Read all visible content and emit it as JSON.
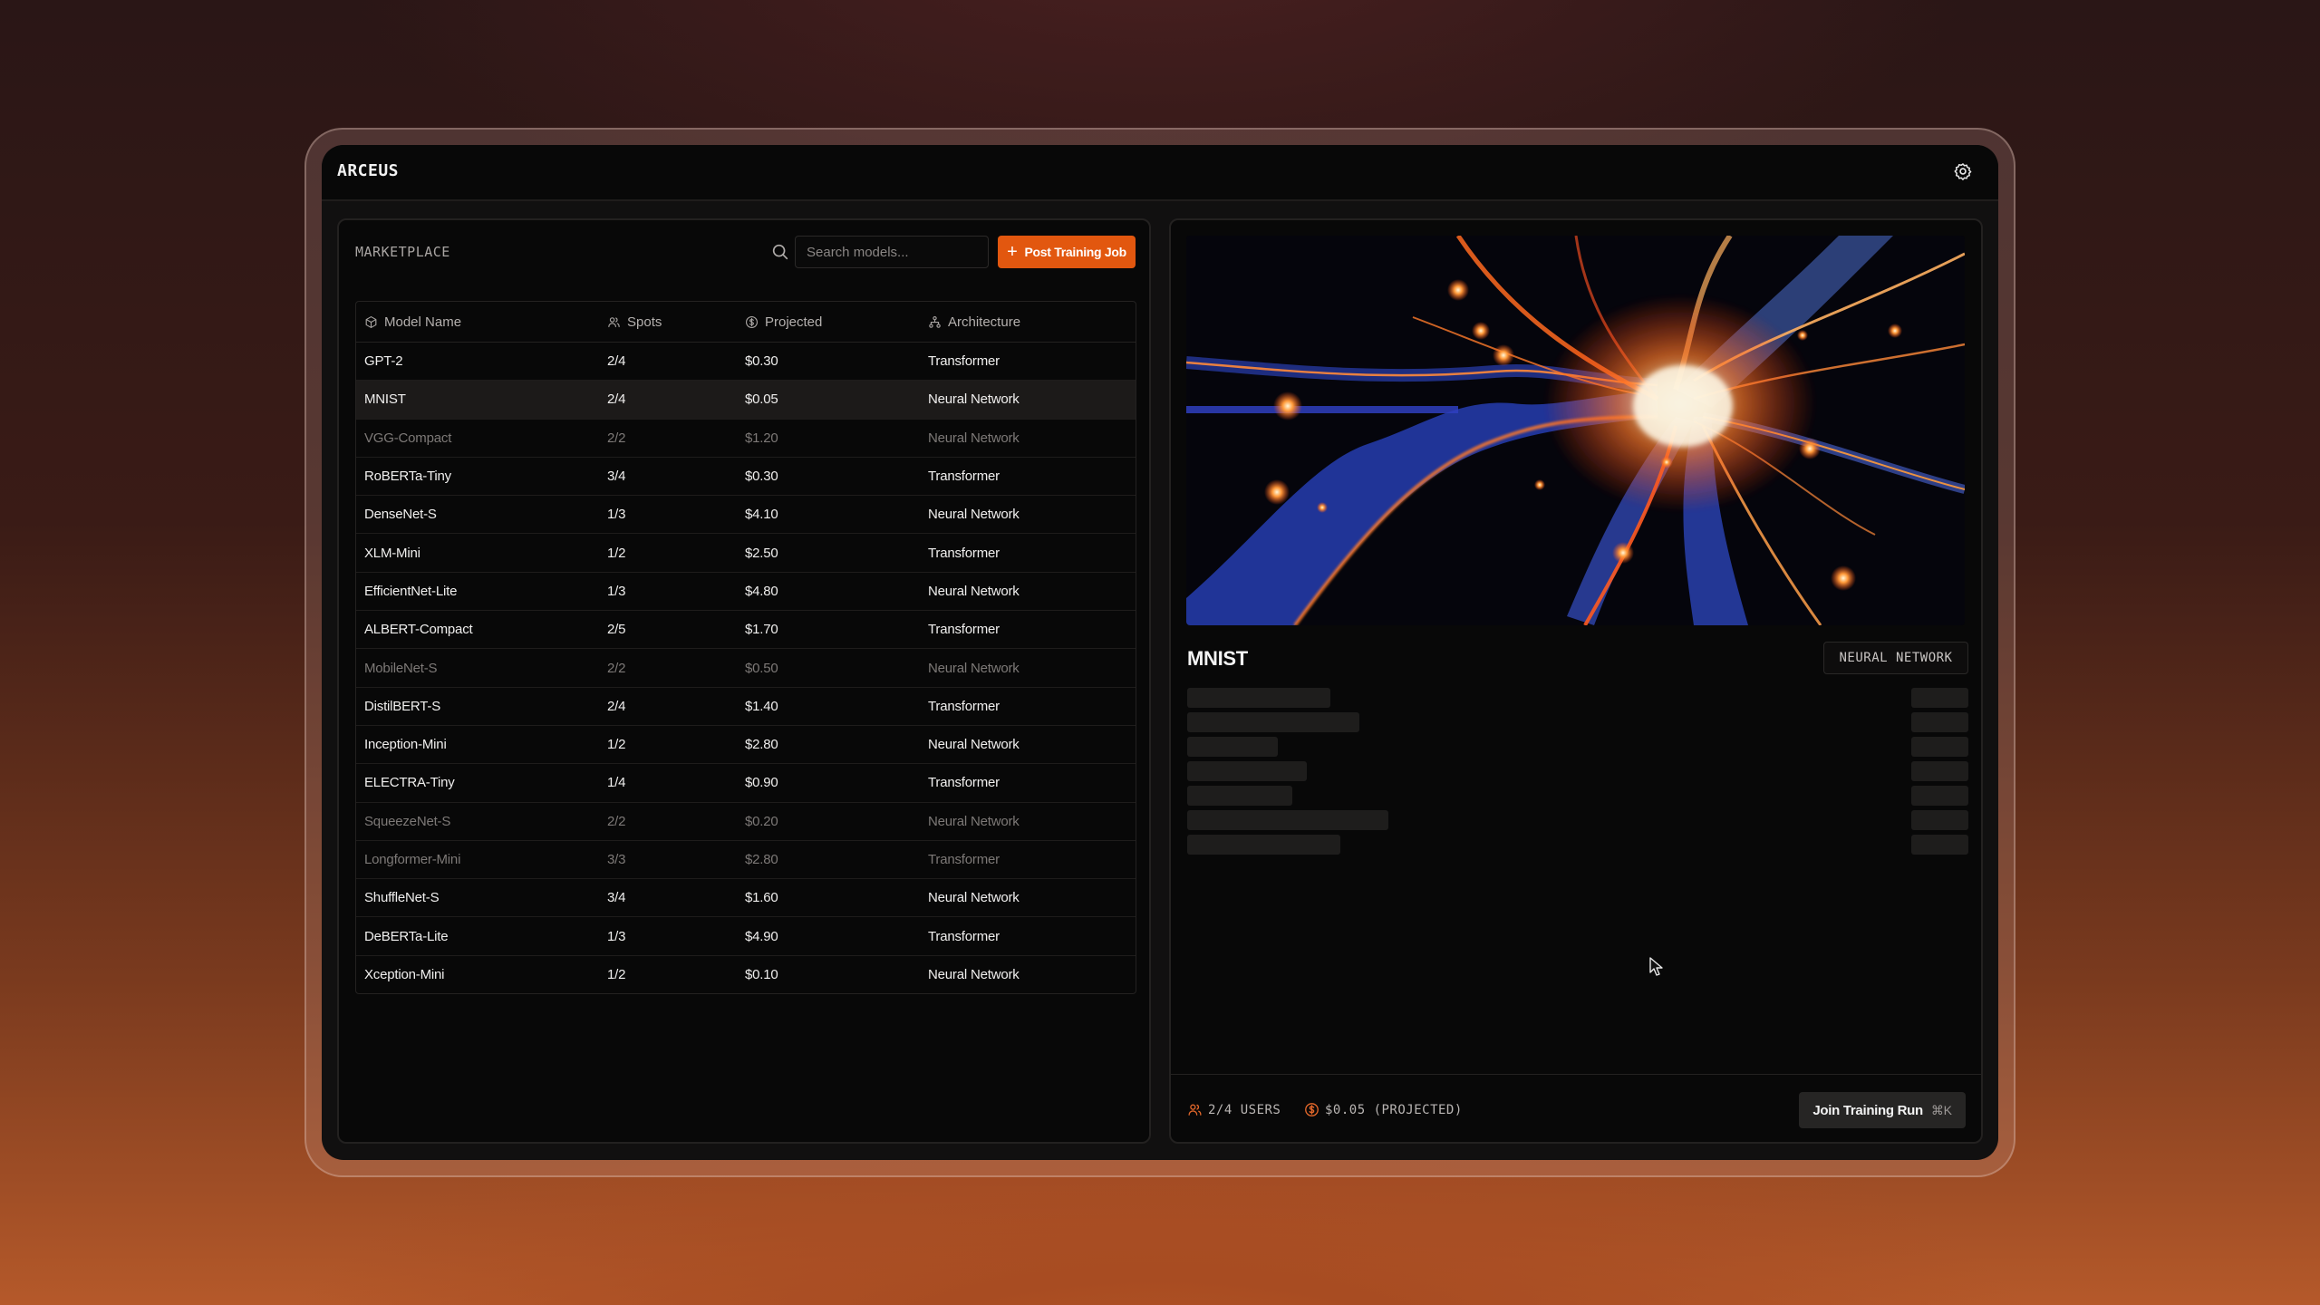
{
  "app": {
    "title": "ARCEUS",
    "settings_icon": "gear-icon"
  },
  "marketplace": {
    "label": "MARKETPLACE",
    "search": {
      "value": "",
      "placeholder": "Search models..."
    },
    "post_button_label": "Post Training Job",
    "columns": [
      {
        "label": "Model Name",
        "icon": "cube-icon"
      },
      {
        "label": "Spots",
        "icon": "users-icon"
      },
      {
        "label": "Projected",
        "icon": "dollar-circle-icon"
      },
      {
        "label": "Architecture",
        "icon": "hierarchy-icon"
      }
    ],
    "rows": [
      {
        "name": "GPT-2",
        "spots": "2/4",
        "projected": "$0.30",
        "architecture": "Transformer",
        "full": false,
        "selected": false
      },
      {
        "name": "MNIST",
        "spots": "2/4",
        "projected": "$0.05",
        "architecture": "Neural Network",
        "full": false,
        "selected": true
      },
      {
        "name": "VGG-Compact",
        "spots": "2/2",
        "projected": "$1.20",
        "architecture": "Neural Network",
        "full": true,
        "selected": false
      },
      {
        "name": "RoBERTa-Tiny",
        "spots": "3/4",
        "projected": "$0.30",
        "architecture": "Transformer",
        "full": false,
        "selected": false
      },
      {
        "name": "DenseNet-S",
        "spots": "1/3",
        "projected": "$4.10",
        "architecture": "Neural Network",
        "full": false,
        "selected": false
      },
      {
        "name": "XLM-Mini",
        "spots": "1/2",
        "projected": "$2.50",
        "architecture": "Transformer",
        "full": false,
        "selected": false
      },
      {
        "name": "EfficientNet-Lite",
        "spots": "1/3",
        "projected": "$4.80",
        "architecture": "Neural Network",
        "full": false,
        "selected": false
      },
      {
        "name": "ALBERT-Compact",
        "spots": "2/5",
        "projected": "$1.70",
        "architecture": "Transformer",
        "full": false,
        "selected": false
      },
      {
        "name": "MobileNet-S",
        "spots": "2/2",
        "projected": "$0.50",
        "architecture": "Neural Network",
        "full": true,
        "selected": false
      },
      {
        "name": "DistilBERT-S",
        "spots": "2/4",
        "projected": "$1.40",
        "architecture": "Transformer",
        "full": false,
        "selected": false
      },
      {
        "name": "Inception-Mini",
        "spots": "1/2",
        "projected": "$2.80",
        "architecture": "Neural Network",
        "full": false,
        "selected": false
      },
      {
        "name": "ELECTRA-Tiny",
        "spots": "1/4",
        "projected": "$0.90",
        "architecture": "Transformer",
        "full": false,
        "selected": false
      },
      {
        "name": "SqueezeNet-S",
        "spots": "2/2",
        "projected": "$0.20",
        "architecture": "Neural Network",
        "full": true,
        "selected": false
      },
      {
        "name": "Longformer-Mini",
        "spots": "3/3",
        "projected": "$2.80",
        "architecture": "Transformer",
        "full": true,
        "selected": false
      },
      {
        "name": "ShuffleNet-S",
        "spots": "3/4",
        "projected": "$1.60",
        "architecture": "Neural Network",
        "full": false,
        "selected": false
      },
      {
        "name": "DeBERTa-Lite",
        "spots": "1/3",
        "projected": "$4.90",
        "architecture": "Transformer",
        "full": false,
        "selected": false
      },
      {
        "name": "Xception-Mini",
        "spots": "1/2",
        "projected": "$0.10",
        "architecture": "Neural Network",
        "full": false,
        "selected": false
      }
    ]
  },
  "detail": {
    "hero_image": "neuron-illustration",
    "title": "MNIST",
    "architecture_badge": "NEURAL NETWORK",
    "loading_rows": 7,
    "footer": {
      "users": "2/4 USERS",
      "projected": "$0.05 (PROJECTED)",
      "join_button_label": "Join Training Run",
      "join_shortcut": "⌘K"
    }
  },
  "colors": {
    "accent": "#e2570f",
    "panel_bg": "#080808",
    "selected_row": "#1c1a19"
  }
}
